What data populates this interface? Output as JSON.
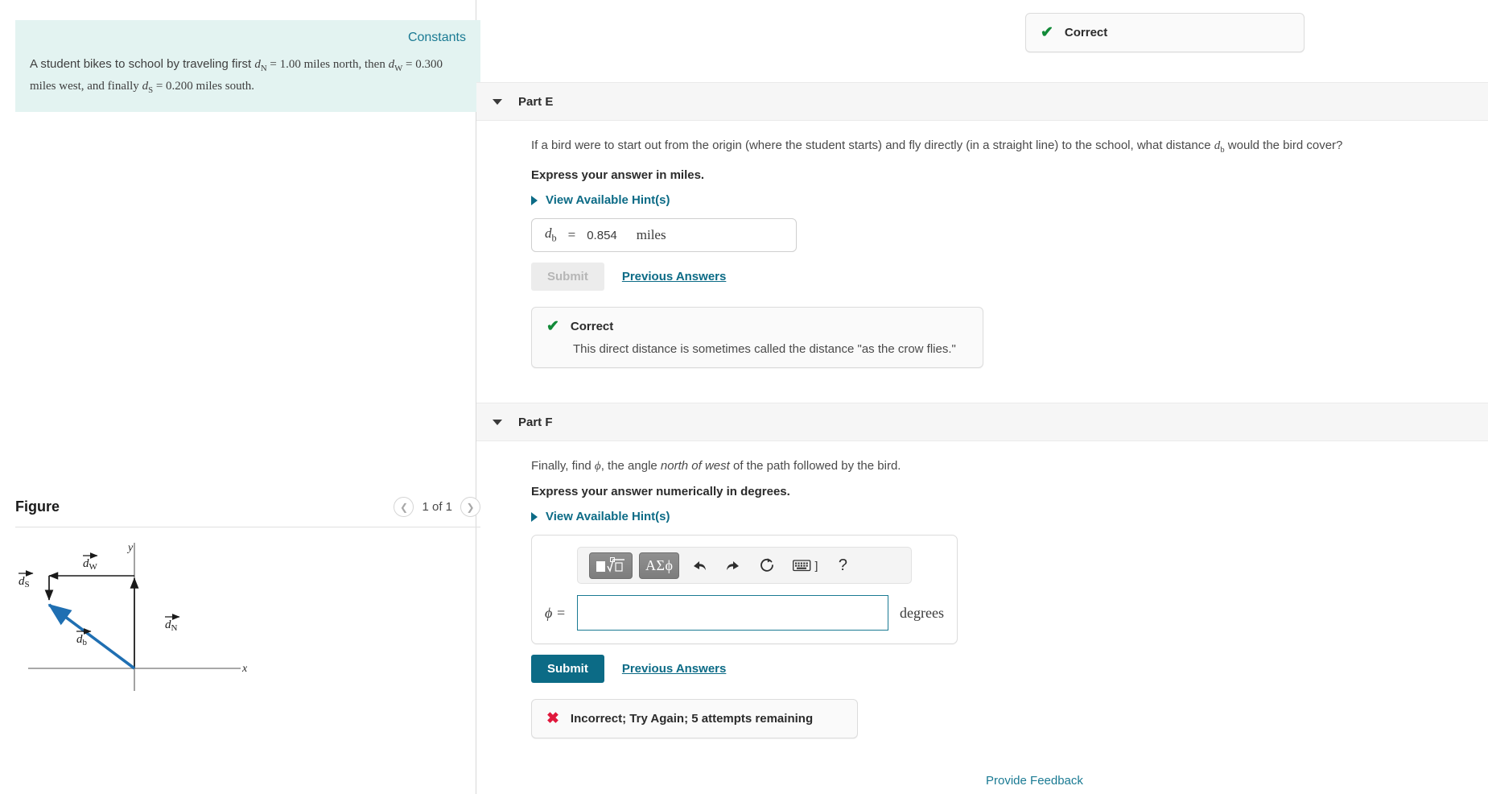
{
  "left": {
    "constants": {
      "link_label": "Constants",
      "problem_prefix": "A student bikes to school by traveling first ",
      "dN_symbol": "d",
      "dN_sub": "N",
      "dN_value": " = 1.00 miles north, then ",
      "dW_symbol": "d",
      "dW_sub": "W",
      "dW_value": " = 0.300 miles west, and finally ",
      "dS_symbol": "d",
      "dS_sub": "S",
      "dS_value": " = 0.200 miles south."
    },
    "figure": {
      "title": "Figure",
      "prev_icon": "chevron-left-icon",
      "counter": "1 of 1",
      "next_icon": "chevron-right-icon",
      "diagram": {
        "axis_x_label": "x",
        "axis_y_label": "y",
        "vec_dN": "d",
        "vec_dN_sub": "N",
        "vec_dW": "d",
        "vec_dW_sub": "W",
        "vec_dS": "d",
        "vec_dS_sub": "S",
        "vec_db": "d",
        "vec_db_sub": "b",
        "vector_color_black": "#1a1a1a",
        "vector_color_blue": "#1f6fb2",
        "axis_color": "#8c8c8c"
      }
    }
  },
  "right": {
    "top_alert": {
      "icon": "check-icon",
      "label": "Correct"
    },
    "part_e": {
      "caret_icon": "caret-down-icon",
      "title": "Part E",
      "question": "If a bird were to start out from the origin (where the student starts) and fly directly (in a straight line) to the school, what distance ",
      "question_var": "d",
      "question_var_sub": "b",
      "question_tail": " would the bird cover?",
      "instruction": "Express your answer in miles.",
      "hints_label": "View Available Hint(s)",
      "answer_var": "d",
      "answer_var_sub": "b",
      "answer_eq": "=",
      "answer_value": "0.854",
      "answer_units": "miles",
      "submit_label": "Submit",
      "submit_disabled": true,
      "previous_answers_label": "Previous Answers",
      "result": {
        "icon": "check-icon",
        "label": "Correct",
        "detail": "This direct distance is sometimes called the distance \"as the crow flies.\""
      }
    },
    "part_f": {
      "caret_icon": "caret-down-icon",
      "title": "Part F",
      "question_pre": "Finally, find ",
      "question_phi": "ϕ",
      "question_mid": ", the angle ",
      "question_em": "north of west",
      "question_post": " of the path followed by the bird.",
      "instruction": "Express your answer numerically in degrees.",
      "hints_label": "View Available Hint(s)",
      "toolbar": {
        "template_key_label": "■√□",
        "greek_key_label": "ΑΣϕ",
        "undo_icon": "undo-arrow-icon",
        "redo_icon": "redo-arrow-icon",
        "reset_icon": "refresh-circle-icon",
        "keyboard_icon": "keyboard-icon",
        "keyboard_bracket": "]",
        "help_icon": "question-mark-icon"
      },
      "answer_var": "ϕ",
      "answer_eq": "=",
      "answer_value": "",
      "answer_placeholder": "",
      "answer_units": "degrees",
      "submit_label": "Submit",
      "previous_answers_label": "Previous Answers",
      "result": {
        "icon": "x-icon",
        "label": "Incorrect; Try Again; 5 attempts remaining"
      }
    },
    "feedback_link": "Provide Feedback"
  },
  "colors": {
    "accent": "#0c6b86",
    "success": "#128a38",
    "error": "#e0183c",
    "constants_bg": "#e3f3f1",
    "panel_bg": "#f6f6f6"
  }
}
